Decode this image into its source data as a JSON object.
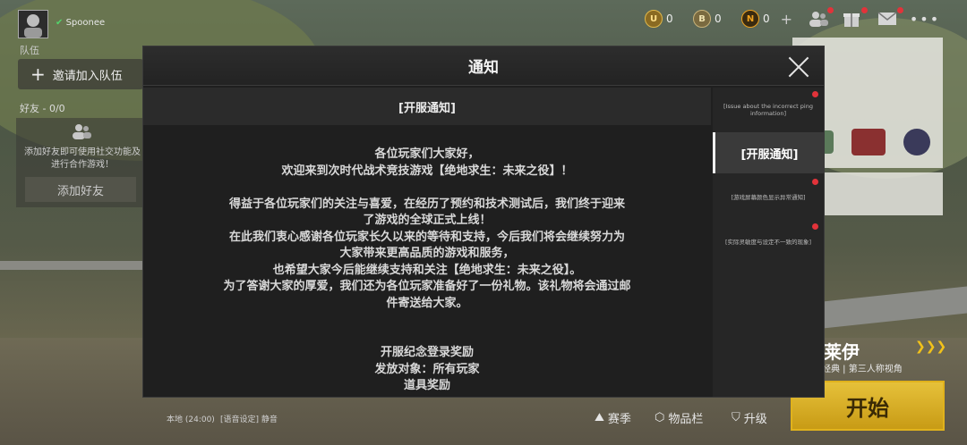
{
  "top": {
    "username": "Spoonee",
    "squad_label": "队伍",
    "currencies": [
      {
        "icon": "uc-coin-icon",
        "symbol": "U",
        "value": "0",
        "color": "#d8a93a"
      },
      {
        "icon": "bp-coin-icon",
        "symbol": "B",
        "value": "0",
        "color": "#b89a4a"
      },
      {
        "icon": "ag-coin-icon",
        "symbol": "N",
        "value": "0",
        "color": "#e0a020"
      }
    ],
    "plus": "+"
  },
  "left": {
    "invite_label": "邀请加入队伍",
    "friends_label": "好友 - 0/0",
    "friends_hint": "添加好友即可使用社交功能及进行合作游戏！",
    "add_friend_label": "添加好友"
  },
  "modal": {
    "title": "通知",
    "content_title": "[开服通知]",
    "body_lines": [
      "各位玩家们大家好，",
      "欢迎来到次时代战术竞技游戏【绝地求生：未来之役】！",
      "",
      "得益于各位玩家们的关注与喜爱，在经历了预约和技术测试后，我们终于迎来",
      "了游戏的全球正式上线！",
      "在此我们衷心感谢各位玩家长久以来的等待和支持，今后我们将会继续努力为",
      "大家带来更高品质的游戏和服务，",
      "也希望大家今后能继续支持和关注【绝地求生：未来之役】。",
      "为了答谢大家的厚爱，我们还为各位玩家准备好了一份礼物。该礼物将会通过邮",
      "件寄送给大家。",
      "",
      "",
      "开服纪念登录奖励",
      "发放对象：所有玩家",
      "道具奖励"
    ],
    "side_items": [
      {
        "label": "[Issue about the incorrect ping information]",
        "active": false
      },
      {
        "label": "[开服通知]",
        "active": true
      },
      {
        "label": "[游戏屏幕颜色显示异常通知]",
        "active": false
      },
      {
        "label": "[实际灵敏度与设定不一致的现象]",
        "active": false
      }
    ]
  },
  "mode": {
    "map_name": "莱伊",
    "sub": "经典 | 第三人称视角",
    "start_label": "开始"
  },
  "bottom": {
    "server": "本地 (24:00)",
    "voice": "[语音设定] 静音",
    "items": [
      "赛季",
      "物品栏",
      "升级"
    ]
  },
  "colors": {
    "accent": "#e0b21c",
    "notify_dot": "#e2333a"
  }
}
